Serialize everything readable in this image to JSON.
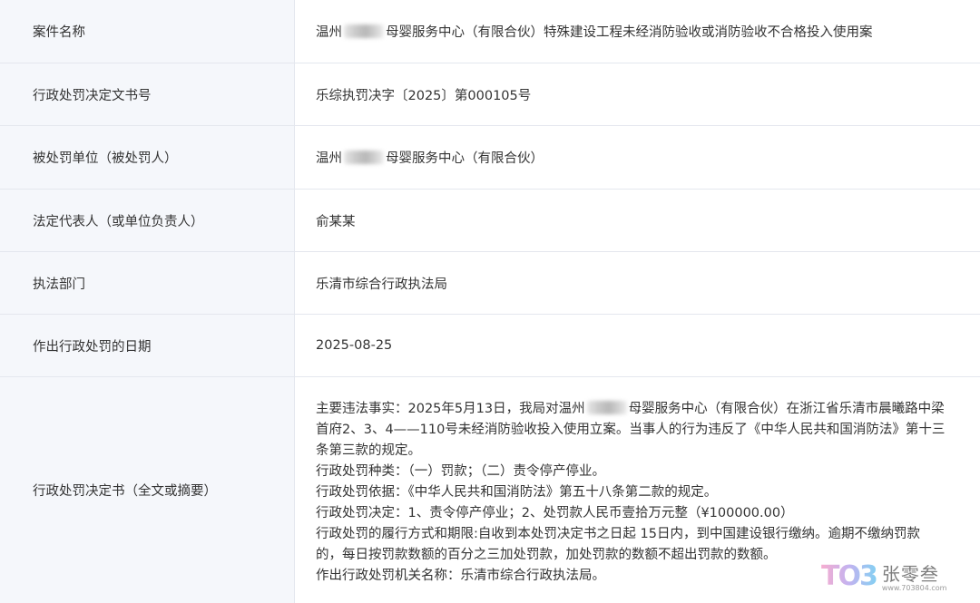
{
  "rows": [
    {
      "label": "案件名称",
      "value_prefix": "温州",
      "value_suffix": "母婴服务中心（有限合伙）特殊建设工程未经消防验收或消防验收不合格投入使用案"
    },
    {
      "label": "行政处罚决定文书号",
      "value": "乐综执罚决字〔2025〕第000105号"
    },
    {
      "label": "被处罚单位（被处罚人）",
      "value_prefix": "温州",
      "value_suffix": "母婴服务中心（有限合伙）"
    },
    {
      "label": "法定代表人（或单位负责人）",
      "value": "俞某某"
    },
    {
      "label": "执法部门",
      "value": "乐清市综合行政执法局"
    },
    {
      "label": "作出行政处罚的日期",
      "value": "2025-08-25"
    },
    {
      "label": "行政处罚决定书（全文或摘要）",
      "lines": [
        "主要违法事实：2025年5月13日，我局对温州",
        "母婴服务中心（有限合伙）在浙江省乐清市晨曦路中梁",
        "首府2、3、4——110号未经消防验收投入使用立案。当事人的行为违反了《中华人民共和国消防法》第十三",
        "条第三款的规定。",
        "行政处罚种类：（一）罚款；（二）责令停产停业。",
        "行政处罚依据：《中华人民共和国消防法》第五十八条第二款的规定。",
        "行政处罚决定：1、责令停产停业；2、处罚款人民币壹拾万元整（¥100000.00）",
        "行政处罚的履行方式和期限:自收到本处罚决定书之日起 15日内，到中国建设银行缴纳。逾期不缴纳罚款",
        "的，每日按罚款数额的百分之三加处罚款，加处罚款的数额不超出罚款的数额。",
        "作出行政处罚机关名称：乐清市综合行政执法局。"
      ]
    }
  ],
  "watermark": {
    "logo": "TO3",
    "name": "张零叁",
    "url": "www.703804.com"
  }
}
